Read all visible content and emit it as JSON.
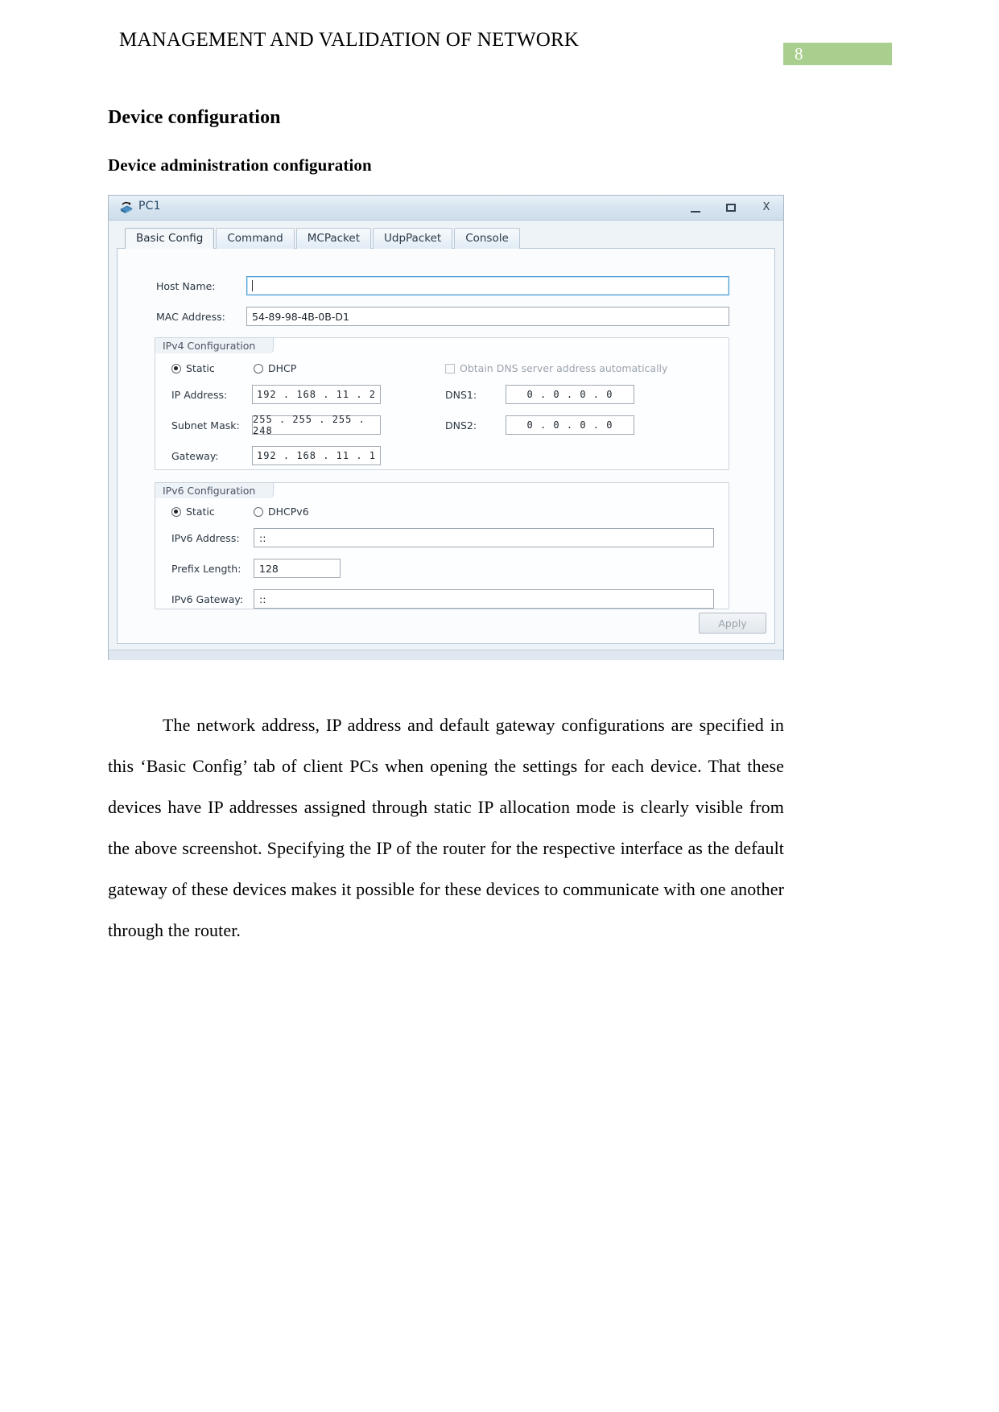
{
  "document": {
    "header_title": "MANAGEMENT AND VALIDATION OF NETWORK",
    "page_number": "8",
    "page_badge_color": "#a9cf8f",
    "heading_1": "Device configuration",
    "heading_2": "Device administration configuration",
    "paragraph": "The network address, IP address and default gateway configurations are specified in this ‘Basic Config’ tab of client PCs when opening the settings for each device. That these devices have IP addresses assigned through static IP allocation mode is clearly visible from the above screenshot. Specifying the IP of the router for the respective interface as the default gateway of these devices makes it possible for these devices to communicate with one another through the router."
  },
  "ensp_window": {
    "title": "PC1",
    "icon": "pc-device-icon",
    "window_controls": {
      "minimize": "–",
      "maximize": "❐",
      "close": "X"
    },
    "tabs": [
      {
        "label": "Basic Config",
        "active": true
      },
      {
        "label": "Command",
        "active": false
      },
      {
        "label": "MCPacket",
        "active": false
      },
      {
        "label": "UdpPacket",
        "active": false
      },
      {
        "label": "Console",
        "active": false
      }
    ],
    "host_name": {
      "label": "Host Name:",
      "value": "",
      "focused": true
    },
    "mac_address": {
      "label": "MAC Address:",
      "value": "54-89-98-4B-0B-D1"
    },
    "ipv4": {
      "group_title": "IPv4 Configuration",
      "mode_static": "Static",
      "mode_dhcp": "DHCP",
      "mode_selected": "Static",
      "obtain_dns_label": "Obtain DNS server address automatically",
      "obtain_dns_checked": false,
      "ip_address_label": "IP Address:",
      "ip_address_value": "192 . 168 .  11  .   2",
      "subnet_mask_label": "Subnet Mask:",
      "subnet_mask_value": "255 . 255 . 255 . 248",
      "gateway_label": "Gateway:",
      "gateway_value": "192 . 168 .  11  .   1",
      "dns1_label": "DNS1:",
      "dns1_value": "0  .  0  .  0  .  0",
      "dns2_label": "DNS2:",
      "dns2_value": "0  .  0  .  0  .  0"
    },
    "ipv6": {
      "group_title": "IPv6 Configuration",
      "mode_static": "Static",
      "mode_dhcpv6": "DHCPv6",
      "mode_selected": "Static",
      "address_label": "IPv6 Address:",
      "address_value": "::",
      "prefix_label": "Prefix Length:",
      "prefix_value": "128",
      "gateway_label": "IPv6 Gateway:",
      "gateway_value": "::"
    },
    "apply_button": "Apply"
  }
}
